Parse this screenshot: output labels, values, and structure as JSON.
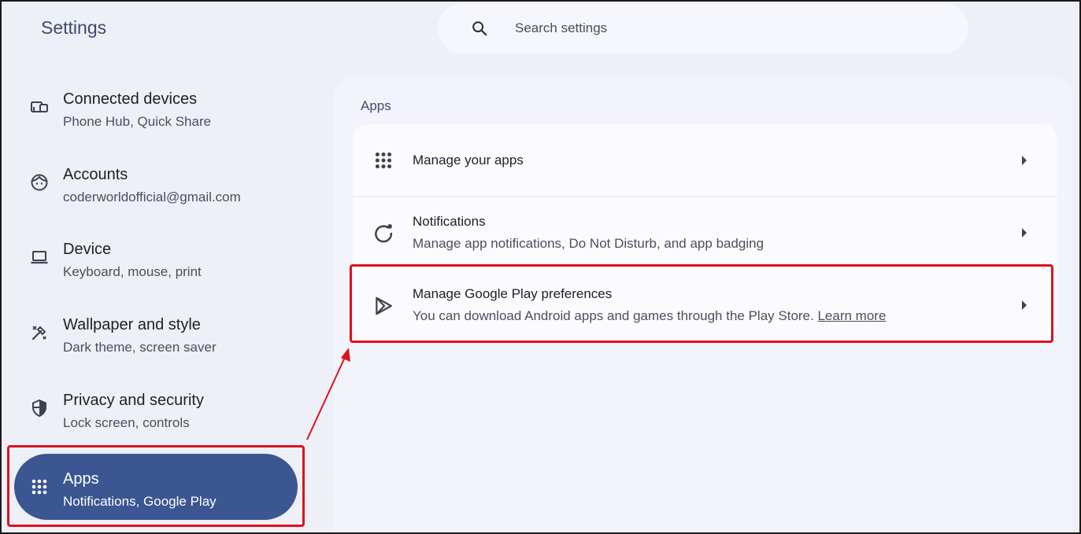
{
  "app": {
    "title": "Settings"
  },
  "search": {
    "placeholder": "Search settings"
  },
  "sidebar": {
    "items": [
      {
        "title": "Connected devices",
        "subtitle": "Phone Hub, Quick Share",
        "icon": "connected-devices-icon"
      },
      {
        "title": "Accounts",
        "subtitle": "coderworldofficial@gmail.com",
        "icon": "account-face-icon"
      },
      {
        "title": "Device",
        "subtitle": "Keyboard, mouse, print",
        "icon": "laptop-icon"
      },
      {
        "title": "Wallpaper and style",
        "subtitle": "Dark theme, screen saver",
        "icon": "paint-brush-icon"
      },
      {
        "title": "Privacy and security",
        "subtitle": "Lock screen, controls",
        "icon": "shield-icon"
      },
      {
        "title": "Apps",
        "subtitle": "Notifications, Google Play",
        "icon": "apps-grid-icon",
        "selected": true
      }
    ]
  },
  "main": {
    "section_title": "Apps",
    "rows": [
      {
        "title": "Manage your apps",
        "subtitle": "",
        "icon": "apps-grid-icon"
      },
      {
        "title": "Notifications",
        "subtitle": "Manage app notifications, Do Not Disturb, and app badging",
        "icon": "notifications-icon"
      },
      {
        "title": "Manage Google Play preferences",
        "subtitle": "You can download Android apps and games through the Play Store.",
        "link": "Learn more",
        "icon": "play-store-icon"
      }
    ]
  },
  "colors": {
    "accent": "#3b5691",
    "highlight": "#e0101e",
    "background": "#eef0f8"
  }
}
